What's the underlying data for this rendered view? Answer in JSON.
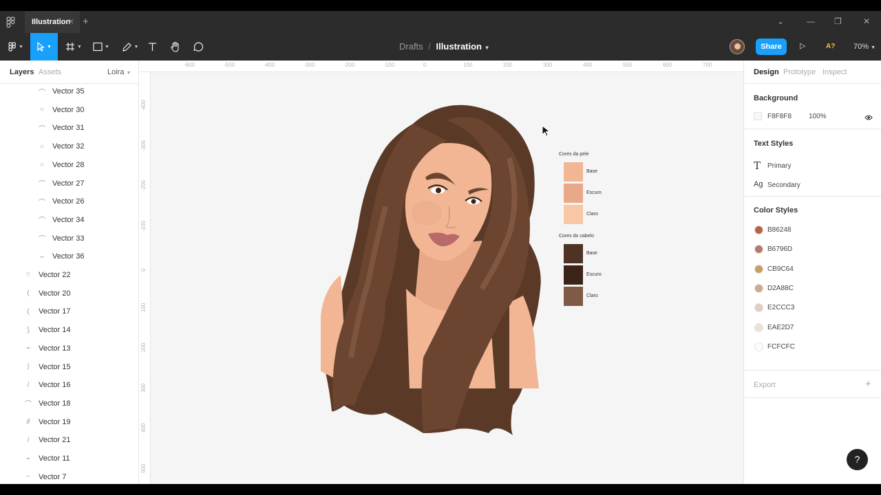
{
  "tab": {
    "title": "Illustration"
  },
  "breadcrumb": {
    "parent": "Drafts",
    "separator": "/",
    "current": "Illustration"
  },
  "toolbar": {
    "share_label": "Share",
    "access_label": "A?",
    "zoom": "70%"
  },
  "left_panel": {
    "tabs": [
      "Layers",
      "Assets"
    ],
    "page": "Loira",
    "layers": [
      {
        "name": "Vector 35",
        "indent": 1
      },
      {
        "name": "Vector 30",
        "indent": 1
      },
      {
        "name": "Vector 31",
        "indent": 1
      },
      {
        "name": "Vector 32",
        "indent": 1
      },
      {
        "name": "Vector 28",
        "indent": 1
      },
      {
        "name": "Vector 27",
        "indent": 1
      },
      {
        "name": "Vector 26",
        "indent": 1
      },
      {
        "name": "Vector 34",
        "indent": 1
      },
      {
        "name": "Vector 33",
        "indent": 1
      },
      {
        "name": "Vector 36",
        "indent": 1
      },
      {
        "name": "Vector 22",
        "indent": 0
      },
      {
        "name": "Vector 20",
        "indent": 0
      },
      {
        "name": "Vector 17",
        "indent": 0
      },
      {
        "name": "Vector 14",
        "indent": 0
      },
      {
        "name": "Vector 13",
        "indent": 0
      },
      {
        "name": "Vector 15",
        "indent": 0
      },
      {
        "name": "Vector 16",
        "indent": 0
      },
      {
        "name": "Vector 18",
        "indent": 0
      },
      {
        "name": "Vector 19",
        "indent": 0
      },
      {
        "name": "Vector 21",
        "indent": 0
      },
      {
        "name": "Vector 11",
        "indent": 0
      },
      {
        "name": "Vector 7",
        "indent": 0
      }
    ]
  },
  "rulers": {
    "horizontal": [
      "-600",
      "-500",
      "-400",
      "-300",
      "-200",
      "-100",
      "0",
      "100",
      "200",
      "300",
      "400",
      "500",
      "600",
      "700"
    ],
    "vertical": [
      "-400",
      "-300",
      "-200",
      "-100",
      "0",
      "100",
      "200",
      "300",
      "400",
      "500"
    ]
  },
  "canvas": {
    "skin_title": "Cores da pele",
    "skin_colors": [
      {
        "label": "Base",
        "color": "#F2B694"
      },
      {
        "label": "Escuro",
        "color": "#E9A887"
      },
      {
        "label": "Claro",
        "color": "#F9C6A6"
      }
    ],
    "hair_title": "Cores do cabelo",
    "hair_colors": [
      {
        "label": "Base",
        "color": "#4E3224"
      },
      {
        "label": "Escuro",
        "color": "#3C2419"
      },
      {
        "label": "Claro",
        "color": "#7E5A47"
      }
    ]
  },
  "right_panel": {
    "tabs": [
      "Design",
      "Prototype",
      "Inspect"
    ],
    "background_title": "Background",
    "background_hex": "F8F8F8",
    "background_opacity": "100%",
    "text_styles_title": "Text Styles",
    "text_styles": [
      {
        "glyph": "T",
        "name": "Primary"
      },
      {
        "glyph": "Ag",
        "name": "Secondary"
      }
    ],
    "color_styles_title": "Color Styles",
    "color_styles": [
      {
        "hex": "B86248",
        "color": "#B86248"
      },
      {
        "hex": "B6796D",
        "color": "#B6796D"
      },
      {
        "hex": "CB9C64",
        "color": "#CB9C64"
      },
      {
        "hex": "D2A88C",
        "color": "#D2A88C"
      },
      {
        "hex": "E2CCC3",
        "color": "#E2CCC3"
      },
      {
        "hex": "EAE2D7",
        "color": "#EAE2D7"
      },
      {
        "hex": "FCFCFC",
        "color": "#FCFCFC"
      }
    ],
    "export_title": "Export",
    "export_add": "+"
  },
  "help_label": "?"
}
